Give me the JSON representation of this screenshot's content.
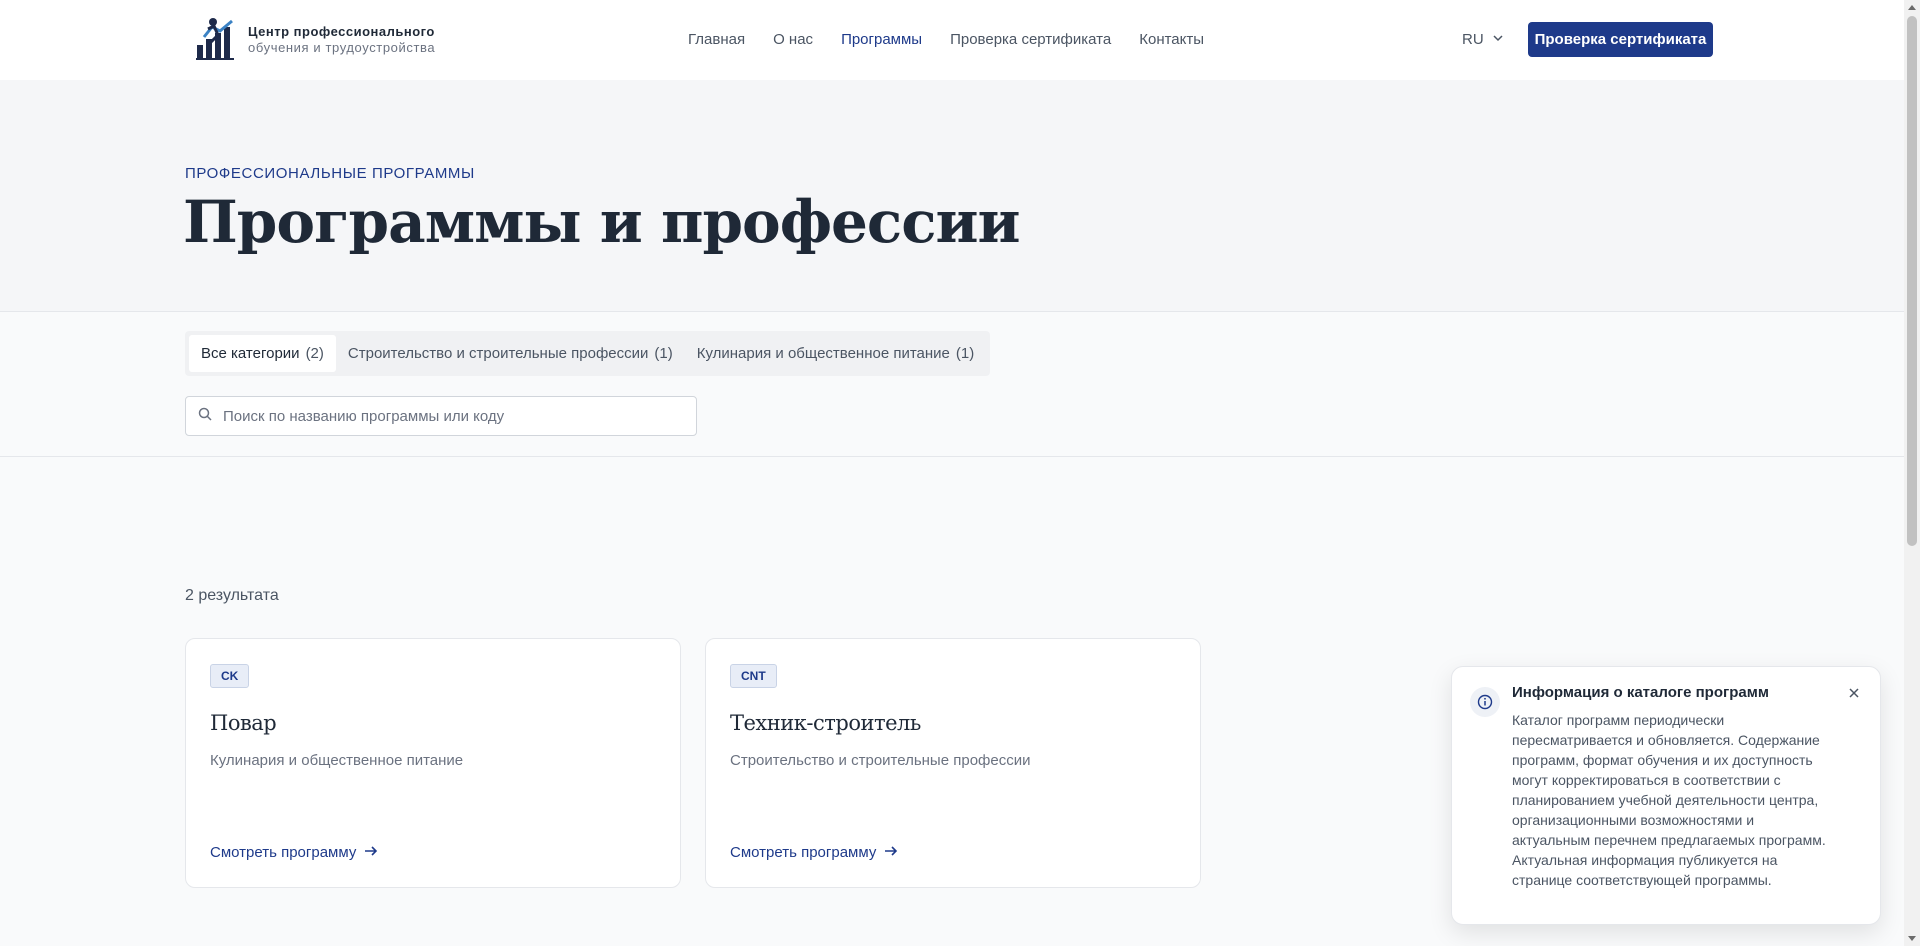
{
  "header": {
    "brand_line1": "Центр профессионального",
    "brand_line2": "обучения и трудоустройства",
    "nav": [
      {
        "label": "Главная",
        "active": false
      },
      {
        "label": "О нас",
        "active": false
      },
      {
        "label": "Программы",
        "active": true
      },
      {
        "label": "Проверка сертификата",
        "active": false
      },
      {
        "label": "Контакты",
        "active": false
      }
    ],
    "lang": "RU",
    "cta_label": "Проверка сертификата"
  },
  "hero": {
    "eyebrow": "ПРОФЕССИОНАЛЬНЫЕ ПРОГРАММЫ",
    "title": "Программы и профессии"
  },
  "filters": {
    "tabs": [
      {
        "label": "Все категории",
        "count": "(2)",
        "active": true
      },
      {
        "label": "Строительство и строительные профессии",
        "count": "(1)",
        "active": false
      },
      {
        "label": "Кулинария и общественное питание",
        "count": "(1)",
        "active": false
      }
    ],
    "search_placeholder": "Поиск по названию программы или коду",
    "search_value": ""
  },
  "results": {
    "count_label": "2 результата",
    "cards": [
      {
        "code": "CK",
        "title": "Повар",
        "category": "Кулинария и общественное питание",
        "link_label": "Смотреть программу"
      },
      {
        "code": "CNT",
        "title": "Техник-строитель",
        "category": "Строительство и строительные профессии",
        "link_label": "Смотреть программу"
      }
    ]
  },
  "toast": {
    "title": "Информация о каталоге программ",
    "body": "Каталог программ периодически пересматривается и обновляется. Содержание программ, формат обучения и их доступность могут корректироваться в соответствии с планированием учебной деятельности центра, организационными возможностями и актуальным перечнем предлагаемых программ. Актуальная информация публикуется на странице соответствующей программы."
  },
  "colors": {
    "primary": "#1e3a8a",
    "text": "#1f2937",
    "muted": "#6b7280",
    "background": "#f9fafb",
    "hero_background": "#f5f6f8",
    "border": "#e5e7eb"
  },
  "icons": {
    "logo": "logo-icon",
    "lang_dropdown": "chevron-down-icon",
    "search": "search-icon",
    "card_link": "arrow-right-icon",
    "toast_info": "info-icon",
    "toast_close": "close-icon"
  }
}
